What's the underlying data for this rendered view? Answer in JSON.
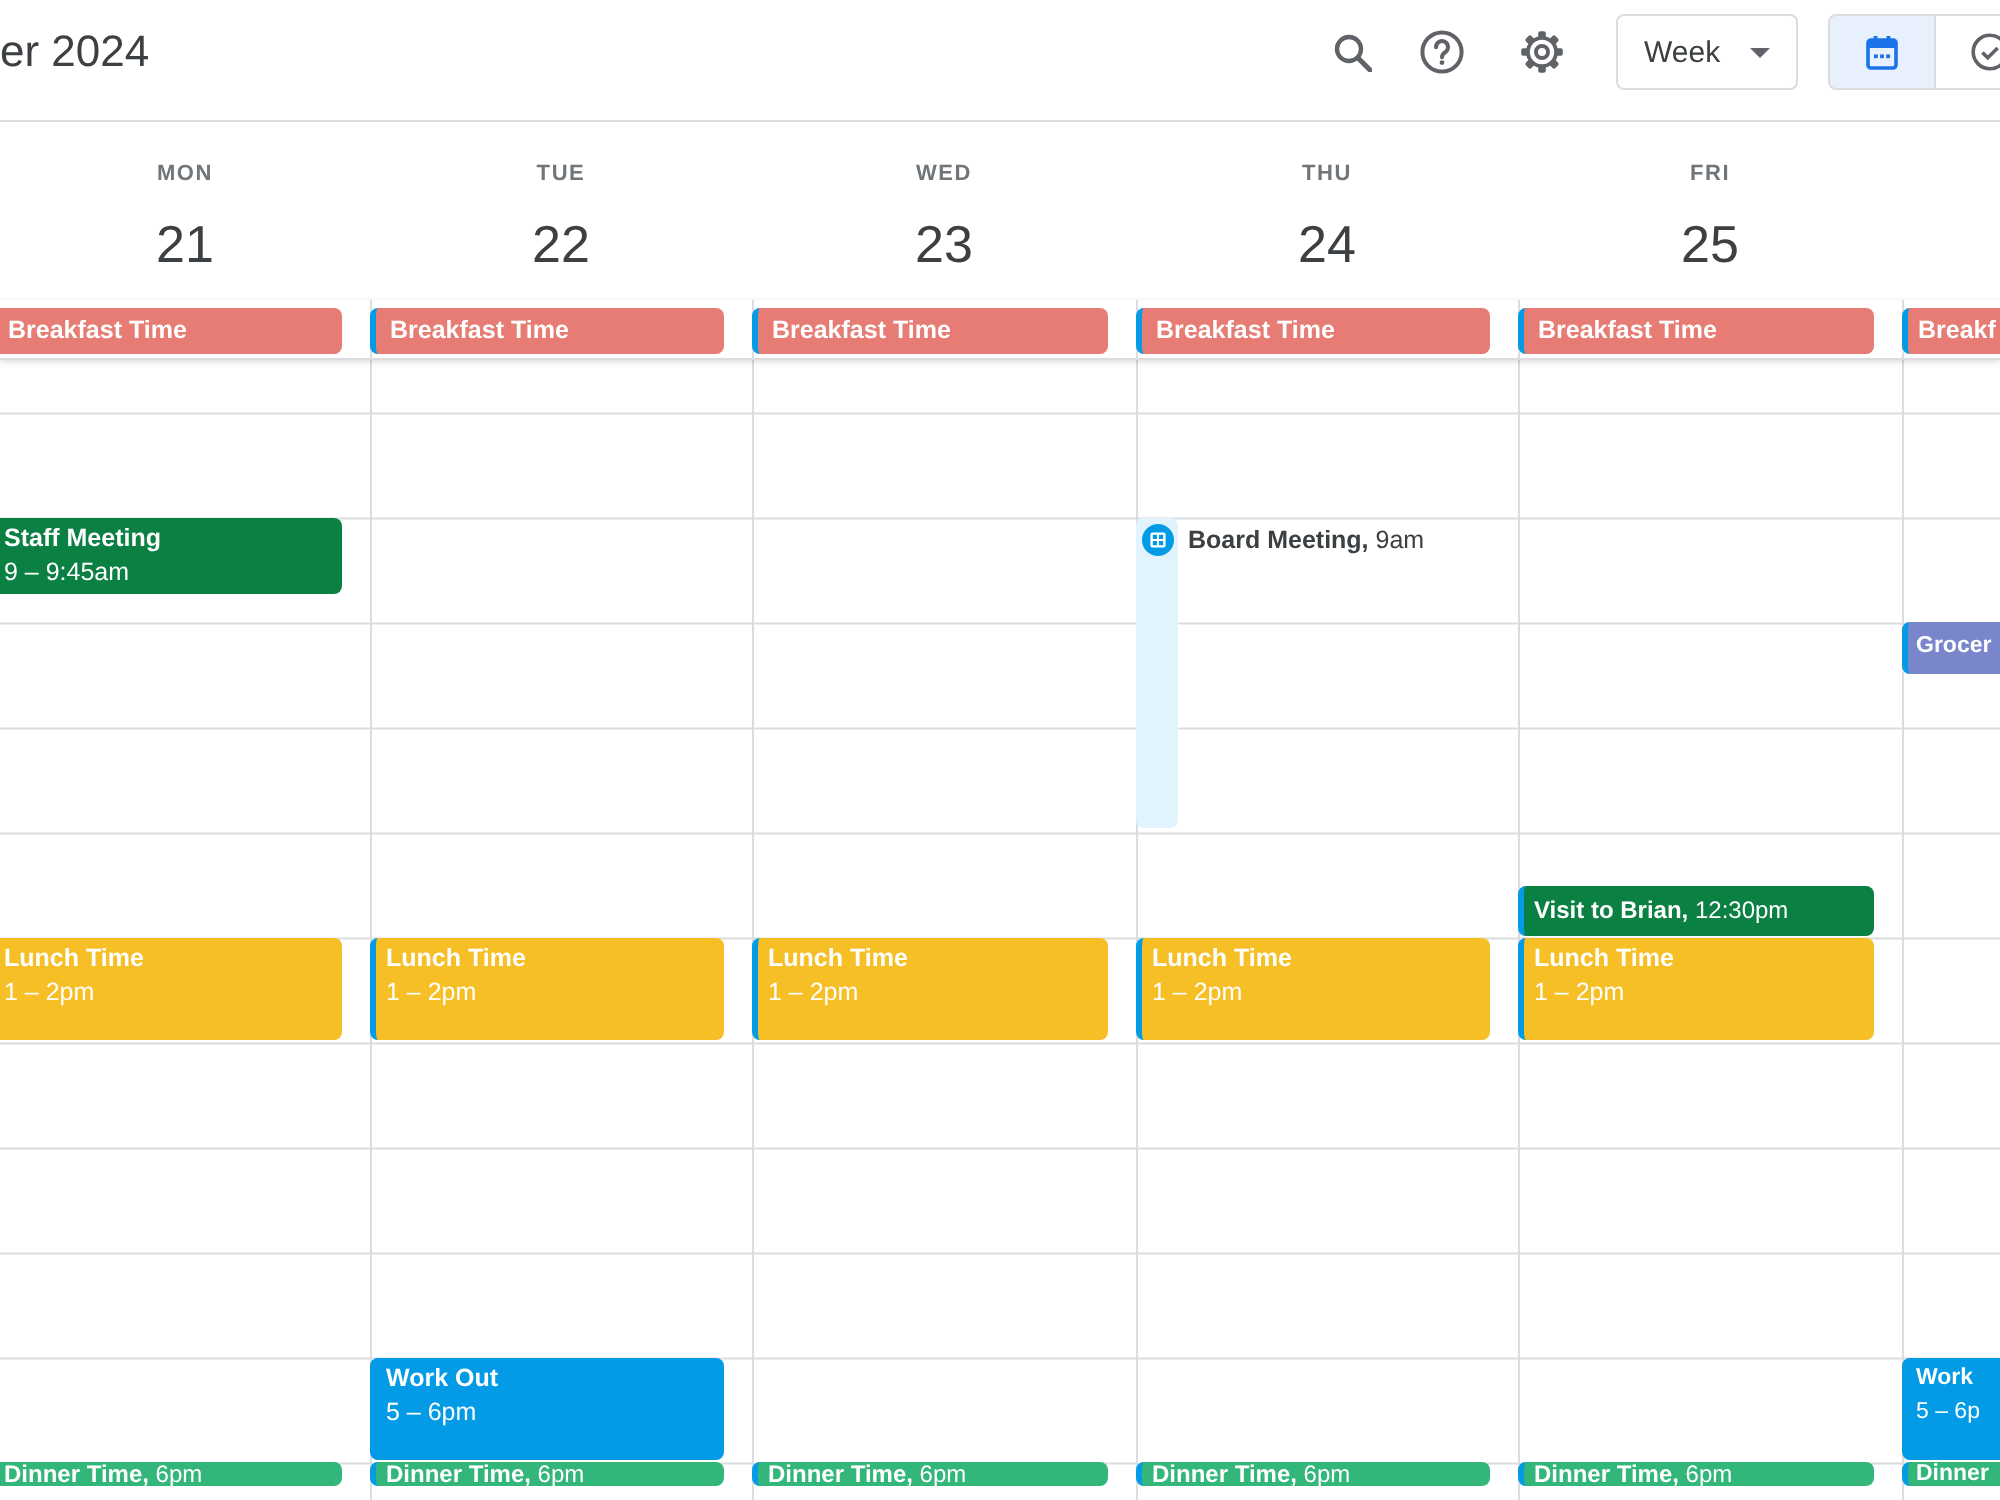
{
  "header": {
    "title": "er 2024",
    "view_menu": {
      "label": "Week"
    },
    "view_toggle": [
      {
        "selected": true
      },
      {
        "selected": false
      }
    ]
  },
  "days": [
    {
      "name": "MON",
      "date": "21",
      "all_day": [
        {
          "title": "Breakfast Time",
          "color": "#e67c73"
        }
      ],
      "events": [
        {
          "kind": "block",
          "title": "Staff Meeting",
          "time": "9 – 9:45am",
          "color": "#0b8043"
        },
        {
          "kind": "block",
          "title": "Lunch Time",
          "time": "1 – 2pm",
          "color": "#f6bf26"
        },
        {
          "kind": "short",
          "title": "Dinner Time,",
          "time": "6pm",
          "color": "#33b679"
        }
      ]
    },
    {
      "name": "TUE",
      "date": "22",
      "all_day": [
        {
          "title": "Breakfast Time",
          "color": "#e67c73"
        }
      ],
      "events": [
        {
          "kind": "block",
          "title": "Lunch Time",
          "time": "1 – 2pm",
          "color": "#f6bf26"
        },
        {
          "kind": "block",
          "title": "Work Out",
          "time": "5 – 6pm",
          "color": "#039be5"
        },
        {
          "kind": "short",
          "title": "Dinner Time,",
          "time": "6pm",
          "color": "#33b679"
        }
      ]
    },
    {
      "name": "WED",
      "date": "23",
      "all_day": [
        {
          "title": "Breakfast Time",
          "color": "#e67c73"
        }
      ],
      "events": [
        {
          "kind": "block",
          "title": "Lunch Time",
          "time": "1 – 2pm",
          "color": "#f6bf26"
        },
        {
          "kind": "short",
          "title": "Dinner Time,",
          "time": "6pm",
          "color": "#33b679"
        }
      ]
    },
    {
      "name": "THU",
      "date": "24",
      "all_day": [
        {
          "title": "Breakfast Time",
          "color": "#e67c73"
        }
      ],
      "events": [
        {
          "kind": "appointment",
          "title": "Board Meeting,",
          "time": "9am",
          "color": "#039be5"
        },
        {
          "kind": "block",
          "title": "Lunch Time",
          "time": "1 – 2pm",
          "color": "#f6bf26"
        },
        {
          "kind": "short",
          "title": "Dinner Time,",
          "time": "6pm",
          "color": "#33b679"
        }
      ]
    },
    {
      "name": "FRI",
      "date": "25",
      "all_day": [
        {
          "title": "Breakfast Time",
          "color": "#e67c73"
        }
      ],
      "events": [
        {
          "kind": "short",
          "title": "Visit to Brian,",
          "time": "12:30pm",
          "color": "#0b8043"
        },
        {
          "kind": "block",
          "title": "Lunch Time",
          "time": "1 – 2pm",
          "color": "#f6bf26"
        },
        {
          "kind": "short",
          "title": "Dinner Time,",
          "time": "6pm",
          "color": "#33b679"
        }
      ]
    },
    {
      "all_day": [
        {
          "title": "Breakf",
          "color": "#e67c73"
        }
      ],
      "events": [
        {
          "kind": "short",
          "title": "Grocer",
          "color": "#7986cb"
        },
        {
          "kind": "block",
          "title": "Work",
          "time": "5 – 6p",
          "color": "#039be5"
        },
        {
          "kind": "short",
          "title": "Dinner",
          "color": "#33b679"
        }
      ]
    }
  ]
}
